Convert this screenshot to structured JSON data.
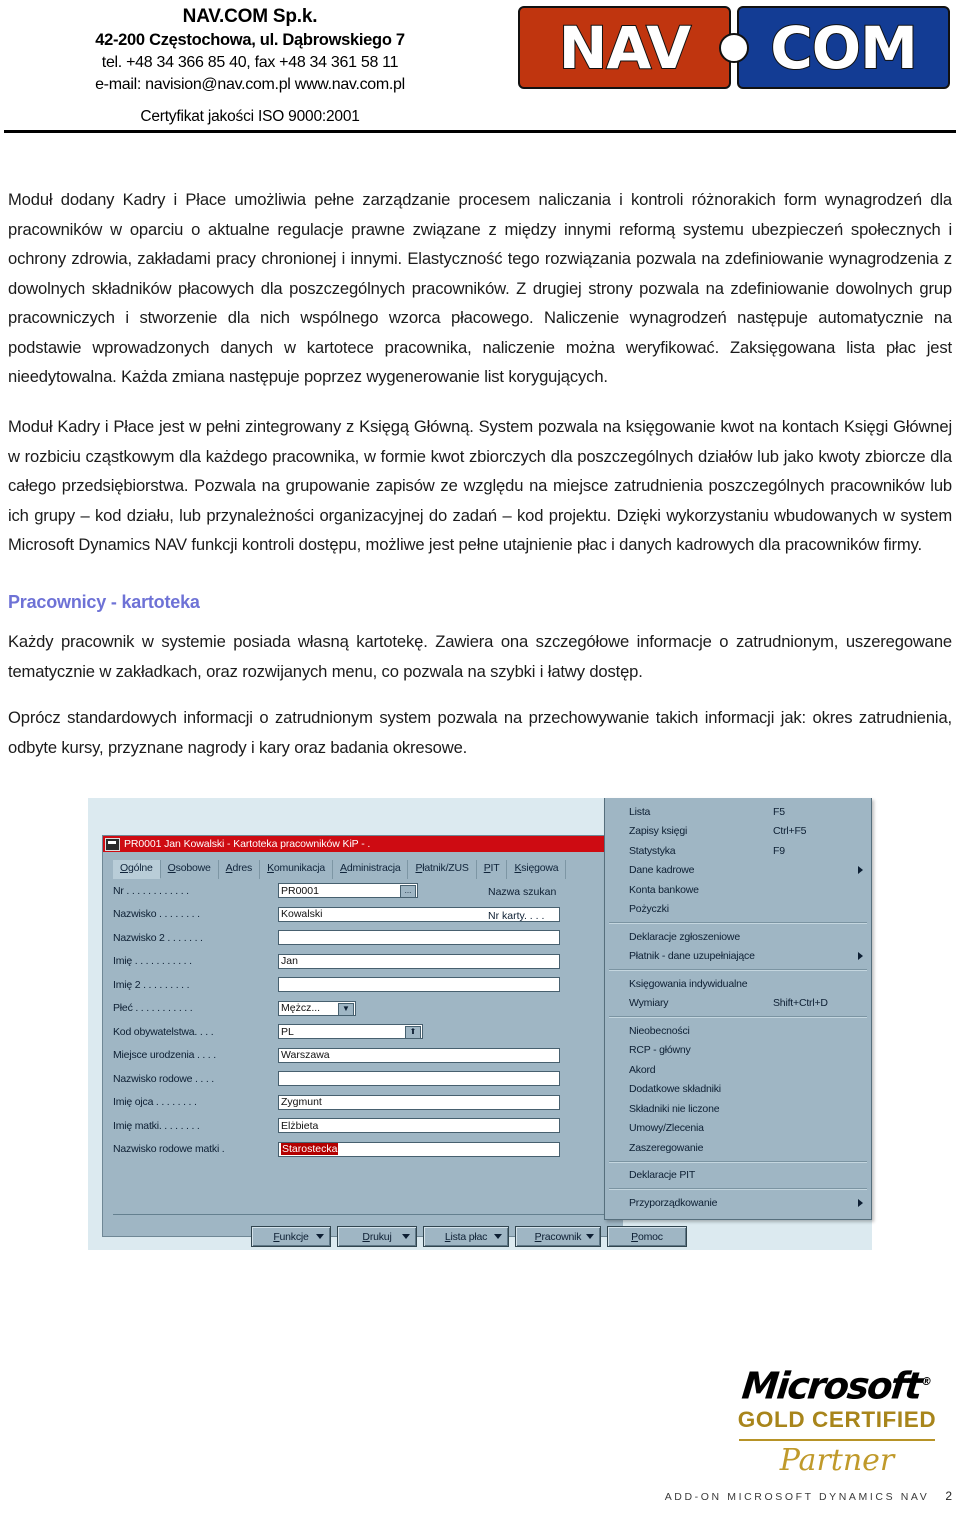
{
  "header": {
    "company_name": "NAV.COM Sp.k.",
    "address": "42-200 Częstochowa, ul. Dąbrowskiego 7",
    "phone": "tel. +48 34 366 85 40, fax +48 34 361 58 11",
    "email_www": "e-mail: navision@nav.com.pl   www.nav.com.pl",
    "iso": "Certyfikat jakości ISO 9000:2001",
    "logo": {
      "left_text": "NAV",
      "right_text": "COM",
      "left_color": "#C0350F",
      "right_color": "#133C94"
    }
  },
  "body": {
    "paragraph1": "Moduł dodany Kadry i Płace umożliwia pełne zarządzanie procesem naliczania i kontroli różnorakich form wynagrodzeń dla pracowników w oparciu o aktualne regulacje prawne związane z między innymi reformą systemu ubezpieczeń społecznych i ochrony zdrowia, zakładami pracy chronionej i innymi. Elastyczność tego rozwiązania pozwala na zdefiniowanie wynagrodzenia z dowolnych składników płacowych dla poszczególnych pracowników. Z drugiej strony pozwala na zdefiniowanie dowolnych grup pracowniczych i stworzenie dla nich wspólnego wzorca płacowego. Naliczenie wynagrodzeń następuje automatycznie na podstawie wprowadzonych danych w kartotece pracownika, naliczenie można weryfikować. Zaksięgowana lista płac jest  nieedytowalna. Każda zmiana następuje poprzez wygenerowanie list korygujących.",
    "paragraph2": "Moduł Kadry i Płace jest w pełni zintegrowany z Księgą Główną. System pozwala na księgowanie kwot na kontach Księgi Głównej w rozbiciu cząstkowym dla każdego pracownika, w formie kwot zbiorczych dla poszczególnych działów lub jako kwoty zbiorcze dla całego przedsiębiorstwa. Pozwala na grupowanie zapisów ze względu na miejsce zatrudnienia poszczególnych pracowników lub ich grupy – kod działu, lub przynależności organizacyjnej do zadań – kod projektu. Dzięki wykorzystaniu wbudowanych w system Microsoft Dynamics NAV funkcji kontroli dostępu, możliwe jest pełne utajnienie płac i danych kadrowych dla pracowników firmy.",
    "section_title": "Pracownicy - kartoteka",
    "section_title_color": "#6E72D6",
    "paragraph3": "Każdy pracownik w systemie posiada własną kartotekę. Zawiera ona szczegółowe informacje o zatrudnionym, uszeregowane tematycznie w zakładkach, oraz rozwijanych menu, co pozwala na szybki i łatwy dostęp.",
    "paragraph4": "Oprócz standardowych informacji o zatrudnionym system pozwala na przechowywanie takich informacji jak: okres zatrudnienia, odbyte kursy, przyznane nagrody i kary oraz badania okresowe."
  },
  "screenshot": {
    "window_title": "PR0001 Jan Kowalski - Kartoteka pracowników KiP - .",
    "titlebar_color": "#CE0B12",
    "tabs": [
      {
        "label": "Ogólne",
        "active": true
      },
      {
        "label": "Osobowe",
        "active": false
      },
      {
        "label": "Adres",
        "active": false
      },
      {
        "label": "Komunikacja",
        "active": false
      },
      {
        "label": "Administracja",
        "active": false
      },
      {
        "label": "Płatnik/ZUS",
        "active": false
      },
      {
        "label": "PIT",
        "active": false
      },
      {
        "label": "Księgowa",
        "active": false
      }
    ],
    "fields": [
      {
        "label": "Nr . . . . . . . . . . . .",
        "value": "PR0001",
        "width": "w-short",
        "button": "..."
      },
      {
        "label": "Nazwisko . . . . . . . .",
        "value": "Kowalski",
        "width": "w-long",
        "button": ""
      },
      {
        "label": "Nazwisko 2 . . . . . . .",
        "value": "",
        "width": "w-long",
        "button": ""
      },
      {
        "label": "Imię . . . . . . . . . . .",
        "value": "Jan",
        "width": "w-long",
        "button": ""
      },
      {
        "label": "Imię 2 . . . . . . . . .",
        "value": "",
        "width": "w-long",
        "button": ""
      },
      {
        "label": "Płeć . . . . . . . . . . .",
        "value": "Mężcz...",
        "width": "w-drop",
        "button": "▼"
      },
      {
        "label": "Kod obywatelstwa. . . .",
        "value": "PL",
        "width": "w-mid",
        "button": "⬆"
      },
      {
        "label": "Miejsce urodzenia . . . .",
        "value": "Warszawa",
        "width": "w-long",
        "button": ""
      },
      {
        "label": "Nazwisko rodowe . . . .",
        "value": "",
        "width": "w-long",
        "button": ""
      },
      {
        "label": "Imię ojca . . . . . . . .",
        "value": "Zygmunt",
        "width": "w-long",
        "button": ""
      },
      {
        "label": "Imię matki. . . . . . . .",
        "value": "Elżbieta",
        "width": "w-long",
        "button": ""
      },
      {
        "label": "Nazwisko rodowe matki  .",
        "value": "Starostecka",
        "width": "w-long",
        "button": "",
        "highlighted": true
      }
    ],
    "right_labels": [
      "Nazwa szukan",
      "Nr karty. . . ."
    ],
    "buttons": [
      {
        "label": "Funkcje",
        "dropdown": true
      },
      {
        "label": "Drukuj",
        "dropdown": true
      },
      {
        "label": "Lista płac",
        "dropdown": true
      },
      {
        "label": "Pracownik",
        "dropdown": true
      },
      {
        "label": "Pomoc",
        "dropdown": false
      }
    ],
    "menu_items": [
      {
        "label": "Lista",
        "shortcut": "F5",
        "submenu": false
      },
      {
        "label": "Zapisy księgi",
        "shortcut": "Ctrl+F5",
        "submenu": false
      },
      {
        "label": "Statystyka",
        "shortcut": "F9",
        "submenu": false
      },
      {
        "label": "Dane kadrowe",
        "shortcut": "",
        "submenu": true
      },
      {
        "label": "Konta bankowe",
        "shortcut": "",
        "submenu": false
      },
      {
        "label": "Pożyczki",
        "shortcut": "",
        "submenu": false
      },
      {
        "separator": true
      },
      {
        "label": "Deklaracje zgłoszeniowe",
        "shortcut": "",
        "submenu": false
      },
      {
        "label": "Płatnik - dane uzupełniające",
        "shortcut": "",
        "submenu": true
      },
      {
        "separator": true
      },
      {
        "label": "Księgowania indywidualne",
        "shortcut": "",
        "submenu": false
      },
      {
        "label": "Wymiary",
        "shortcut": "Shift+Ctrl+D",
        "submenu": false
      },
      {
        "separator": true
      },
      {
        "label": "Nieobecności",
        "shortcut": "",
        "submenu": false
      },
      {
        "label": "RCP - główny",
        "shortcut": "",
        "submenu": false
      },
      {
        "label": "Akord",
        "shortcut": "",
        "submenu": false
      },
      {
        "label": "Dodatkowe składniki",
        "shortcut": "",
        "submenu": false
      },
      {
        "label": "Składniki nie liczone",
        "shortcut": "",
        "submenu": false
      },
      {
        "label": "Umowy/Zlecenia",
        "shortcut": "",
        "submenu": false
      },
      {
        "label": "Zaszeregowanie",
        "shortcut": "",
        "submenu": false
      },
      {
        "separator": true
      },
      {
        "label": "Deklaracje PIT",
        "shortcut": "",
        "submenu": false
      },
      {
        "separator": true
      },
      {
        "label": "Przyporządkowanie",
        "shortcut": "",
        "submenu": true
      }
    ]
  },
  "ms_logo": {
    "microsoft": "Microsoft",
    "registered": "®",
    "gold_certified": "GOLD CERTIFIED",
    "partner": "Partner",
    "gold_color": "#A8851B"
  },
  "footer": {
    "text": "ADD-ON MICROSOFT DYNAMICS NAV",
    "page_number": "2"
  }
}
